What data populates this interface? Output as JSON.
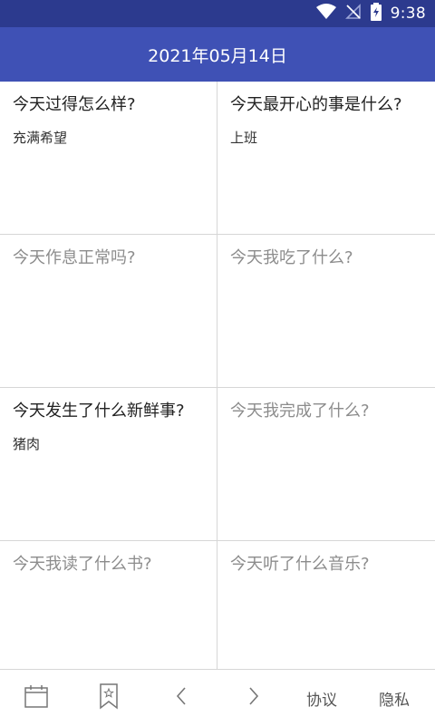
{
  "status_bar": {
    "time": "9:38"
  },
  "header": {
    "title": "2021年05月14日"
  },
  "cards": [
    {
      "question": "今天过得怎么样?",
      "answer": "充满希望",
      "answered": true
    },
    {
      "question": "今天最开心的事是什么?",
      "answer": "上班",
      "answered": true
    },
    {
      "question": "今天作息正常吗?",
      "answer": "",
      "answered": false
    },
    {
      "question": "今天我吃了什么?",
      "answer": "",
      "answered": false
    },
    {
      "question": "今天发生了什么新鲜事?",
      "answer": "猪肉",
      "answered": true
    },
    {
      "question": "今天我完成了什么?",
      "answer": "",
      "answered": false
    },
    {
      "question": "今天我读了什么书?",
      "answer": "",
      "answered": false
    },
    {
      "question": "今天听了什么音乐?",
      "answer": "",
      "answered": false
    }
  ],
  "bottom_nav": {
    "icons": [
      "calendar-icon",
      "bookmark-icon",
      "chevron-left-icon",
      "chevron-right-icon"
    ],
    "agreement_label": "协议",
    "privacy_label": "隐私"
  },
  "colors": {
    "status_bar": "#2c3a8e",
    "app_bar": "#3f51b5",
    "question_answered": "#222222",
    "question_unanswered": "#8c8c8c",
    "divider": "#d6d6d6"
  }
}
